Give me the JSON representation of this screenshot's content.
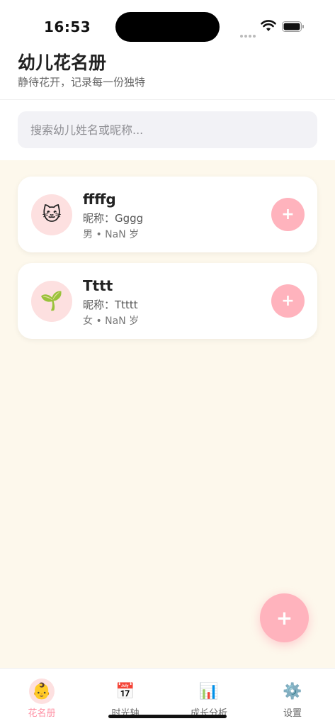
{
  "status_bar": {
    "time": "16:53"
  },
  "header": {
    "title": "幼儿花名册",
    "subtitle": "静待花开，记录每一份独特"
  },
  "search": {
    "placeholder": "搜索幼儿姓名或昵称..."
  },
  "children": [
    {
      "avatar": "🐱",
      "name": "ffffg",
      "nickname": "昵称：Gggg",
      "meta": "男 • NaN 岁",
      "add_label": "+"
    },
    {
      "avatar": "🌱",
      "name": "Tttt",
      "nickname": "昵称：Ttttt",
      "meta": "女 • NaN 岁",
      "add_label": "+"
    }
  ],
  "fab": {
    "label": "+"
  },
  "tabs": [
    {
      "icon": "👶",
      "label": "花名册",
      "active": true
    },
    {
      "icon": "📅",
      "label": "时光轴",
      "active": false
    },
    {
      "icon": "📊",
      "label": "成长分析",
      "active": false
    },
    {
      "icon": "⚙️",
      "label": "设置",
      "active": false
    }
  ],
  "colors": {
    "accent": "#ffb3bd",
    "accent_text": "#ff8fa3",
    "list_bg": "#fdf8ec",
    "avatar_bg": "#fde0e0"
  }
}
